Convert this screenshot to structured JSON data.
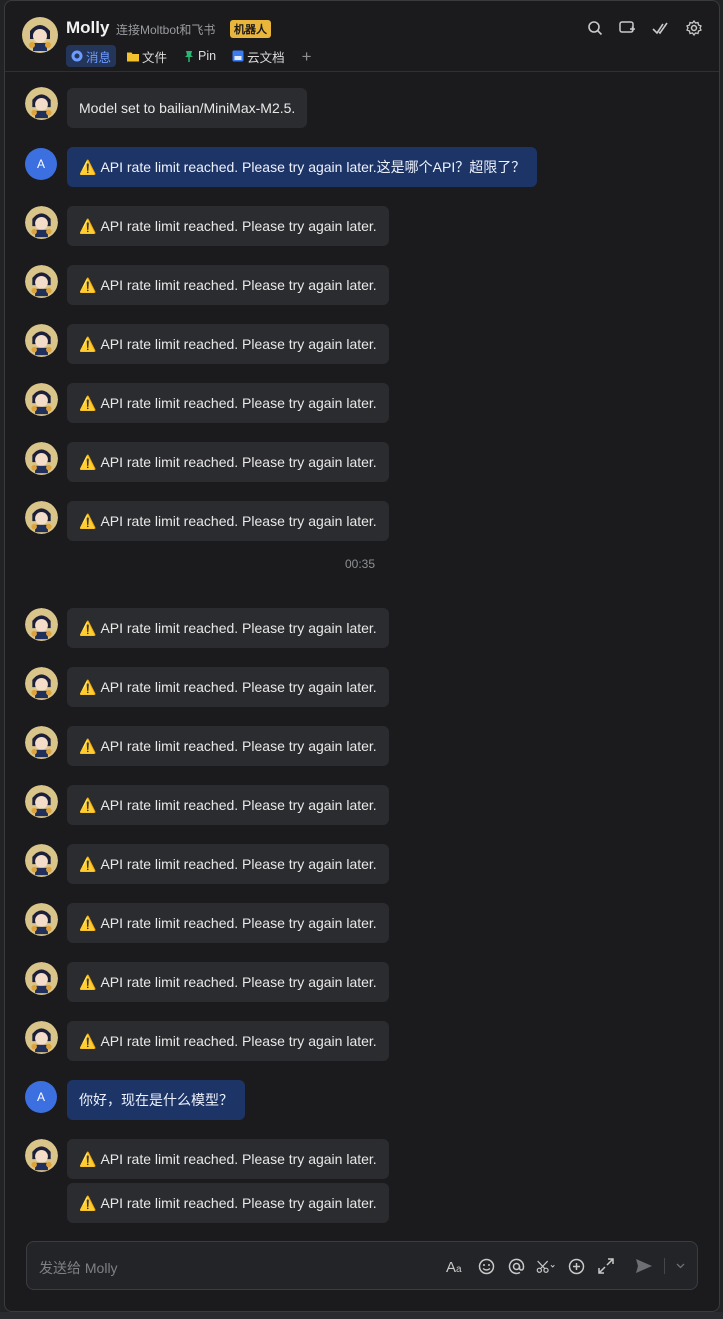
{
  "header": {
    "title": "Molly",
    "subtitle": "连接Moltbot和飞书",
    "badge": "机器人",
    "tabs": [
      {
        "label": "消息",
        "icon": "chat-bubble-icon",
        "active": true
      },
      {
        "label": "文件",
        "icon": "folder-icon",
        "active": false
      },
      {
        "label": "Pin",
        "icon": "pin-icon",
        "active": false
      },
      {
        "label": "云文档",
        "icon": "doc-icon",
        "active": false
      }
    ],
    "add_tab": "+",
    "right_icons": [
      "search-icon",
      "add-chat-icon",
      "check-icon",
      "settings-icon"
    ]
  },
  "user": {
    "initial": "A"
  },
  "messages": {
    "m0": "Model set to bailian/MiniMax-M2.5.",
    "m1": "API rate limit reached. Please try again later.这是哪个API？超限了？",
    "rate": "API rate limit reached. Please try again later.",
    "m_user2": "你好，现在是什么模型？"
  },
  "timestamp": "00:35",
  "composer": {
    "placeholder": "发送给 Molly",
    "tools": [
      "font-format-icon",
      "emoji-icon",
      "mention-icon",
      "scissors-icon",
      "plus-circle-icon",
      "expand-icon",
      "send-icon",
      "chevron-down-icon"
    ]
  },
  "colors": {
    "background": "#1b1b1d",
    "bubble": "#2b2c2f",
    "user_bubble": "#1d3466",
    "accent": "#3c6fe0",
    "badge": "#e8b63a"
  }
}
